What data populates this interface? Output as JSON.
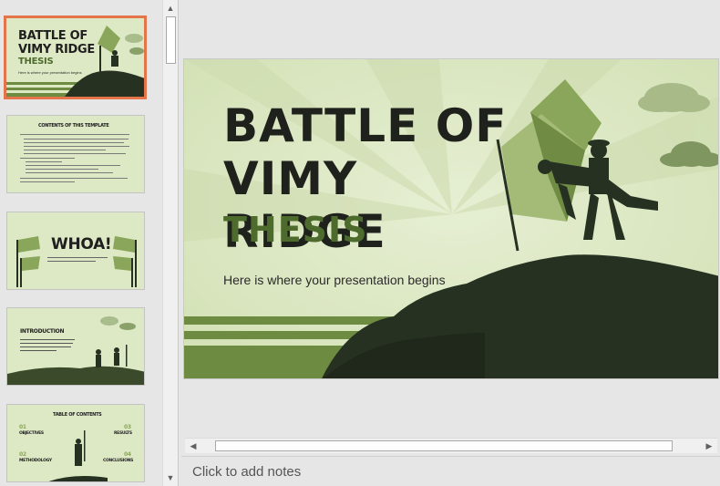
{
  "thumbnails": [
    {
      "title_line1": "BATTLE OF",
      "title_line2": "VIMY RIDGE",
      "subtitle": "THESIS",
      "body": "Here is where your presentation begins"
    },
    {
      "title": "CONTENTS OF THIS TEMPLATE"
    },
    {
      "title": "WHOA!"
    },
    {
      "title": "INTRODUCTION"
    },
    {
      "title": "TABLE OF CONTENTS",
      "items": [
        {
          "num": "01",
          "label": "OBJECTIVES"
        },
        {
          "num": "02",
          "label": "METHODOLOGY"
        },
        {
          "num": "03",
          "label": "RESULTS"
        },
        {
          "num": "04",
          "label": "CONCLUSIONS"
        }
      ]
    }
  ],
  "slide": {
    "title_line1": "BATTLE OF",
    "title_line2": "VIMY RIDGE",
    "subtitle": "THESIS",
    "body": "Here is where your presentation begins"
  },
  "notes": {
    "placeholder": "Click to add notes"
  },
  "colors": {
    "accent_selection": "#e4744a",
    "slide_bg": "#dde8c4",
    "dark_green": "#263122",
    "olive": "#4e6b2e",
    "flag_green": "#8aa65a"
  }
}
